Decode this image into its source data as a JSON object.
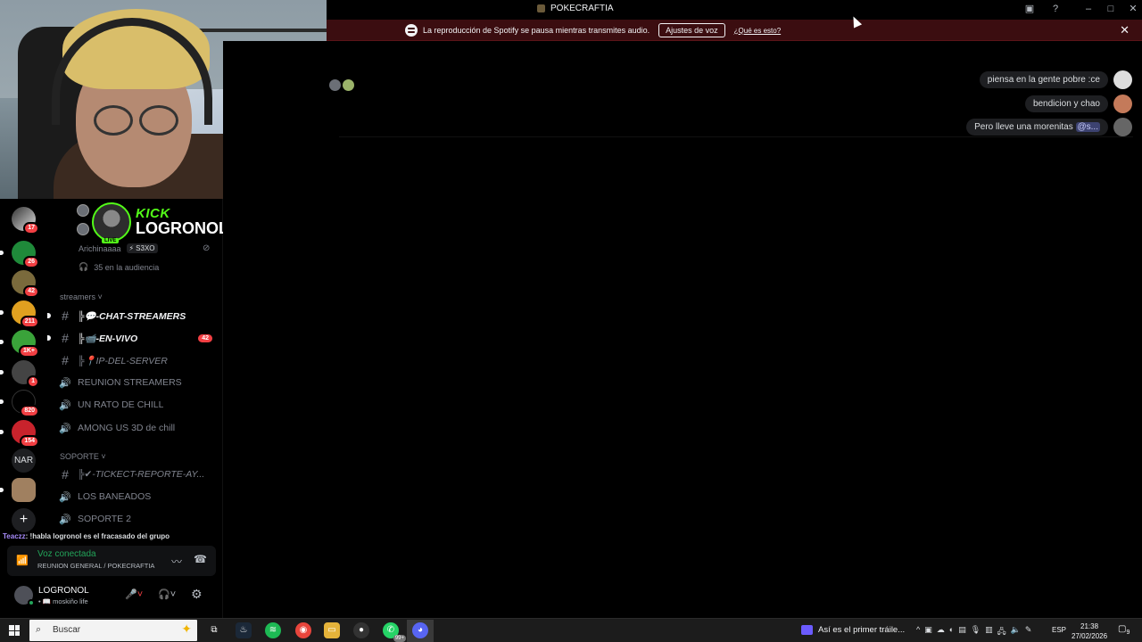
{
  "window": {
    "title": "POKECRAFTIA",
    "buttons": [
      "screen-share",
      "help",
      "minimize",
      "maximize",
      "close"
    ]
  },
  "notice": {
    "text": "La reproducción de Spotify se pausa mientras transmites audio.",
    "button": "Ajustes de voz",
    "link": "¿Qué es esto?",
    "close": "✕",
    "color": "#3b0d10"
  },
  "servers": [
    {
      "icon": "server-icon",
      "badge": "17"
    },
    {
      "icon": "server-icon",
      "badge": "26"
    },
    {
      "icon": "server-icon",
      "badge": "42"
    },
    {
      "icon": "server-icon",
      "badge": "211"
    },
    {
      "icon": "server-icon",
      "badge": "1K+"
    },
    {
      "icon": "server-icon",
      "badge": "1"
    },
    {
      "icon": "server-icon",
      "badge": "820"
    },
    {
      "icon": "server-icon",
      "badge": "154"
    },
    {
      "text": "NAR"
    },
    {
      "icon": "server-icon"
    },
    {
      "icon": "add-server-icon",
      "text": "+"
    }
  ],
  "stream": {
    "platform": "KICK",
    "streamer": "LOGRONOL",
    "live": "LIVE",
    "viewer_user": "Arichinaaaa",
    "viewer_tag": "S3XO",
    "audience": "35 en la audiencia",
    "accent": "#53fc18"
  },
  "categories": {
    "streamers": "streamers",
    "soporte": "SOPORTE"
  },
  "channels": {
    "chat_streamers": "╠💬-CHAT-STREAMERS",
    "en_vivo": "╠📹-EN-VIVO",
    "en_vivo_badge": "42",
    "ip_server": "╠📍IP-DEL-SERVER",
    "reunion": "REUNION STREAMERS",
    "chill": "UN RATO DE CHILL",
    "among": "AMONG US 3D de chill",
    "ticket": "╠✔-TICKECT-REPORTE-AY...",
    "baneados": "LOS BANEADOS",
    "soporte2": "SOPORTE 2"
  },
  "overlay_chat": {
    "user": "Teaczz",
    "text": ": !habla logronol es el fracasado del grupo"
  },
  "voice": {
    "status": "Voz conectada",
    "location": "REUNION GENERAL / POKECRAFTIA",
    "status_color": "#23a55a"
  },
  "user": {
    "name": "LOGRONOL",
    "status": "• 📖 moskiño life"
  },
  "messages": [
    {
      "text": "piensa en la gente pobre :ce"
    },
    {
      "text": "bendicion y chao"
    },
    {
      "text": "Pero lleve una morenitas",
      "mention": "@s..."
    }
  ],
  "taskbar": {
    "search_placeholder": "Buscar",
    "whatsapp_count": "99+",
    "news": "Así es el primer tráile...",
    "lang": "ESP",
    "time": "21:38",
    "date": "27/02/2026",
    "notif": "9"
  }
}
